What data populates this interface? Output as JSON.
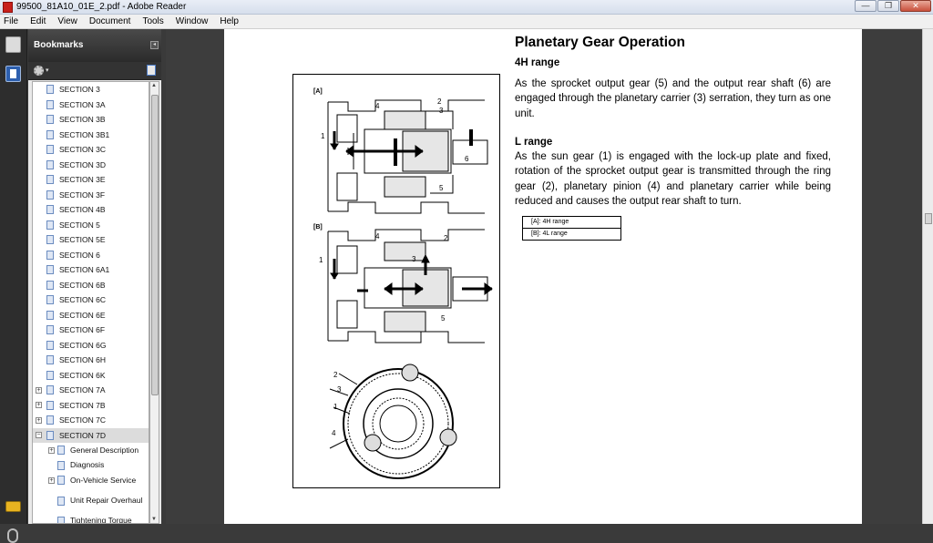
{
  "window": {
    "title": "99500_81A10_01E_2.pdf - Adobe Reader",
    "buttons": {
      "minimize": "—",
      "restore": "❐",
      "close": "✕"
    }
  },
  "menubar": {
    "items": [
      "File",
      "Edit",
      "View",
      "Document",
      "Tools",
      "Window",
      "Help"
    ]
  },
  "bookmarks": {
    "header": "Bookmarks",
    "items": [
      {
        "label": "SECTION 3",
        "expandable": false,
        "level": 1
      },
      {
        "label": "SECTION 3A",
        "expandable": false,
        "level": 1
      },
      {
        "label": "SECTION 3B",
        "expandable": false,
        "level": 1
      },
      {
        "label": "SECTION 3B1",
        "expandable": false,
        "level": 1
      },
      {
        "label": "SECTION 3C",
        "expandable": false,
        "level": 1
      },
      {
        "label": "SECTION 3D",
        "expandable": false,
        "level": 1
      },
      {
        "label": "SECTION 3E",
        "expandable": false,
        "level": 1
      },
      {
        "label": "SECTION 3F",
        "expandable": false,
        "level": 1
      },
      {
        "label": "SECTION 4B",
        "expandable": false,
        "level": 1
      },
      {
        "label": "SECTION 5",
        "expandable": false,
        "level": 1
      },
      {
        "label": "SECTION 5E",
        "expandable": false,
        "level": 1
      },
      {
        "label": "SECTION 6",
        "expandable": false,
        "level": 1
      },
      {
        "label": "SECTION 6A1",
        "expandable": false,
        "level": 1
      },
      {
        "label": "SECTION 6B",
        "expandable": false,
        "level": 1
      },
      {
        "label": "SECTION 6C",
        "expandable": false,
        "level": 1
      },
      {
        "label": "SECTION 6E",
        "expandable": false,
        "level": 1
      },
      {
        "label": "SECTION 6F",
        "expandable": false,
        "level": 1
      },
      {
        "label": "SECTION 6G",
        "expandable": false,
        "level": 1
      },
      {
        "label": "SECTION 6H",
        "expandable": false,
        "level": 1
      },
      {
        "label": "SECTION 6K",
        "expandable": false,
        "level": 1
      },
      {
        "label": "SECTION 7A",
        "expandable": true,
        "level": 1
      },
      {
        "label": "SECTION 7B",
        "expandable": true,
        "level": 1
      },
      {
        "label": "SECTION 7C",
        "expandable": true,
        "level": 1
      },
      {
        "label": "SECTION 7D",
        "expandable": true,
        "expanded": true,
        "level": 1,
        "selected": true
      },
      {
        "label": "General Description",
        "expandable": true,
        "level": 2
      },
      {
        "label": "Diagnosis",
        "expandable": false,
        "level": 2
      },
      {
        "label": "On-Vehicle Service",
        "expandable": true,
        "level": 2
      },
      {
        "label": "Unit Repair Overhaul",
        "expandable": false,
        "level": 2,
        "tall": true
      },
      {
        "label": "Tightening Torque",
        "expandable": false,
        "level": 2
      }
    ]
  },
  "document": {
    "heading": "Planetary Gear Operation",
    "sub_4h": "4H range",
    "para_4h": "As the sprocket output gear (5) and the output rear shaft (6) are engaged through the planetary carrier (3) serration, they turn as one unit.",
    "sub_l": "L range",
    "para_l": "As the sun gear (1) is engaged with the lock-up plate and fixed, rotation of the sprocket output gear is transmitted through the ring gear (2), planetary pinion (4) and planetary carrier while being reduced and causes the output rear shaft to turn.",
    "legend": [
      "[A]:   4H range",
      "[B]:   4L range"
    ],
    "figure": {
      "label_a": "[A]",
      "label_b": "[B]",
      "callouts_a": [
        "4",
        "2",
        "3",
        "1",
        "6",
        "5"
      ],
      "callouts_b": [
        "4",
        "2",
        "3",
        "1",
        "5"
      ],
      "callouts_c": [
        "2",
        "3",
        "1",
        "4"
      ]
    }
  }
}
